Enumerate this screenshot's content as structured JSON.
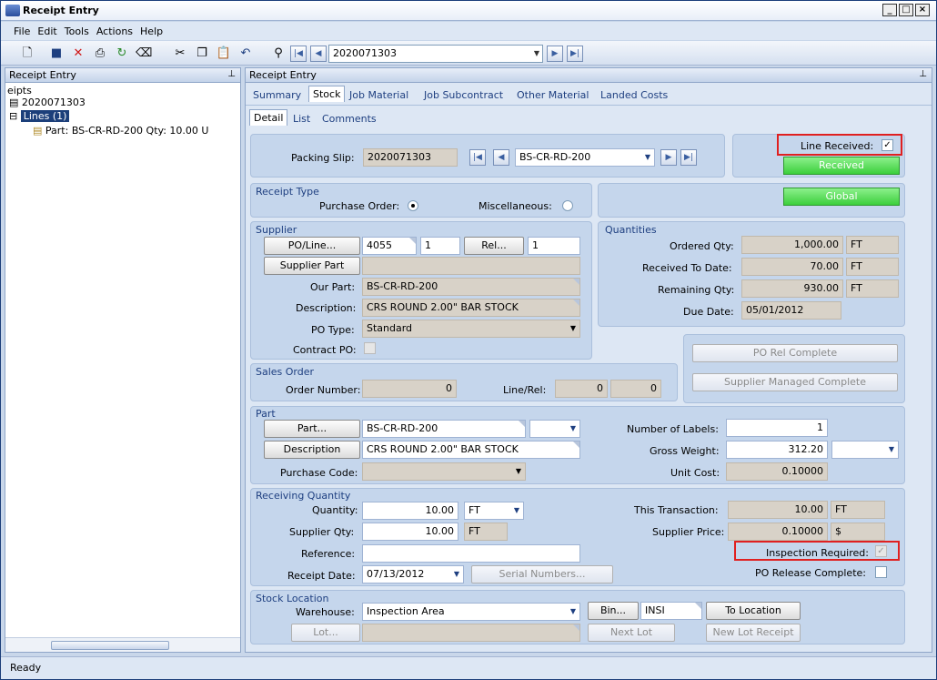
{
  "window": {
    "title": "Receipt Entry"
  },
  "menu": [
    "File",
    "Edit",
    "Tools",
    "Actions",
    "Help"
  ],
  "toolbar": {
    "record": "2020071303"
  },
  "left": {
    "header": "Receipt Entry",
    "tree": [
      "eipts",
      "2020071303",
      "Lines (1)",
      "Part: BS-CR-RD-200 Qty: 10.00 U"
    ]
  },
  "right": {
    "header": "Receipt Entry"
  },
  "tabs": [
    "Summary",
    "Stock",
    "Job Material",
    "Job Subcontract",
    "Other Material",
    "Landed Costs"
  ],
  "subtabs": [
    "Detail",
    "List",
    "Comments"
  ],
  "packing": {
    "label": "Packing Slip:",
    "value": "2020071303",
    "part": "BS-CR-RD-200"
  },
  "line_received": {
    "label": "Line Received:",
    "checked": true,
    "button": "Received"
  },
  "global_button": "Global",
  "receipt_type": {
    "title": "Receipt Type",
    "po": "Purchase Order:",
    "misc": "Miscellaneous:"
  },
  "supplier": {
    "title": "Supplier",
    "po_line_btn": "PO/Line...",
    "po": "4055",
    "line": "1",
    "rel_btn": "Rel...",
    "rel": "1",
    "supplier_part_btn": "Supplier Part",
    "our_part_label": "Our Part:",
    "our_part": "BS-CR-RD-200",
    "desc_label": "Description:",
    "desc": "CRS ROUND 2.00\" BAR STOCK",
    "po_type_label": "PO Type:",
    "po_type": "Standard",
    "contract_label": "Contract PO:"
  },
  "quantities": {
    "title": "Quantities",
    "ordered_label": "Ordered Qty:",
    "ordered": "1,000.00",
    "ordered_uom": "FT",
    "received_label": "Received To Date:",
    "received": "70.00",
    "received_uom": "FT",
    "remaining_label": "Remaining Qty:",
    "remaining": "930.00",
    "remaining_uom": "FT",
    "due_label": "Due Date:",
    "due": "05/01/2012"
  },
  "complete": {
    "po_rel": "PO Rel Complete",
    "supplier_managed": "Supplier Managed Complete"
  },
  "sales_order": {
    "title": "Sales Order",
    "order_label": "Order Number:",
    "order": "0",
    "linerel_label": "Line/Rel:",
    "line": "0",
    "rel": "0"
  },
  "part": {
    "title": "Part",
    "part_btn": "Part...",
    "part": "BS-CR-RD-200",
    "desc_btn": "Description",
    "desc": "CRS ROUND 2.00\" BAR STOCK",
    "purchase_code_label": "Purchase Code:",
    "labels_label": "Number of Labels:",
    "labels": "1",
    "gross_label": "Gross Weight:",
    "gross": "312.20",
    "unit_cost_label": "Unit Cost:",
    "unit_cost": "0.10000"
  },
  "receiving": {
    "title": "Receiving Quantity",
    "qty_label": "Quantity:",
    "qty": "10.00",
    "qty_uom": "FT",
    "supp_qty_label": "Supplier Qty:",
    "supp_qty": "10.00",
    "supp_uom": "FT",
    "ref_label": "Reference:",
    "date_label": "Receipt Date:",
    "date": "07/13/2012",
    "serial_btn": "Serial Numbers...",
    "this_trans_label": "This Transaction:",
    "this_trans": "10.00",
    "this_trans_uom": "FT",
    "supp_price_label": "Supplier Price:",
    "supp_price": "0.10000",
    "supp_price_cur": "$",
    "inspection_label": "Inspection Required:",
    "po_rel_complete_label": "PO Release Complete:"
  },
  "stock_location": {
    "title": "Stock Location",
    "warehouse_label": "Warehouse:",
    "warehouse": "Inspection Area",
    "bin_btn": "Bin...",
    "bin": "INSI",
    "to_location_btn": "To Location",
    "lot_btn": "Lot...",
    "next_lot_btn": "Next Lot",
    "new_lot_btn": "New Lot Receipt"
  },
  "status": "Ready"
}
